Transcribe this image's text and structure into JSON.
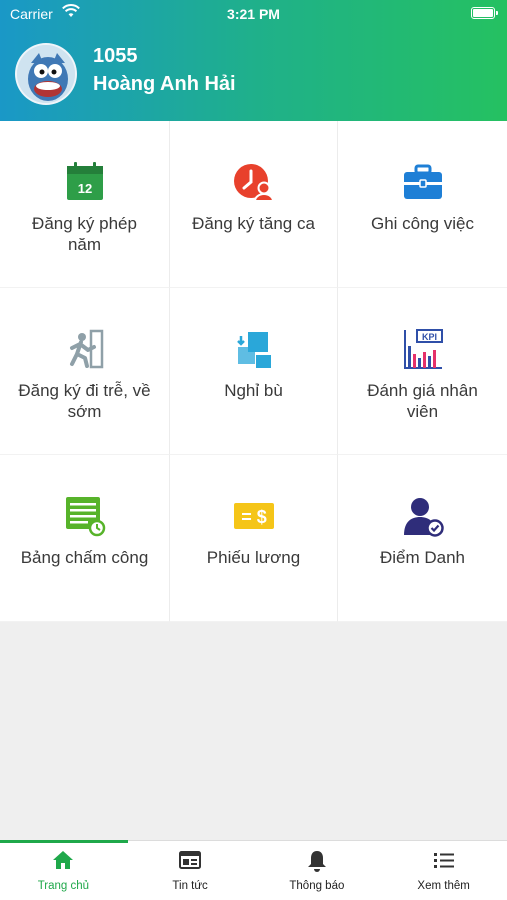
{
  "status_bar": {
    "carrier": "Carrier",
    "time": "3:21 PM",
    "battery_level": 1.0
  },
  "user": {
    "id": "1055",
    "name": "Hoàng Anh Hải"
  },
  "menu_items": [
    {
      "label": "Đăng ký phép năm",
      "icon": "calendar-icon",
      "calendar_day": "12",
      "color": "#2e9e48"
    },
    {
      "label": "Đăng ký tăng ca",
      "icon": "overtime-icon",
      "color": "#e8412c"
    },
    {
      "label": "Ghi công việc",
      "icon": "briefcase-icon",
      "color": "#1e7fd6"
    },
    {
      "label": "Đăng ký đi trễ, về sớm",
      "icon": "exit-running-icon",
      "color": "#8fa0a8"
    },
    {
      "label": "Nghỉ bù",
      "icon": "swap-squares-icon",
      "color": "#2aa7d9"
    },
    {
      "label": "Đánh giá nhân viên",
      "icon": "kpi-chart-icon",
      "kpi_text": "KPI",
      "color": "#2f4fa8"
    },
    {
      "label": "Bảng chấm công",
      "icon": "timesheet-icon",
      "color": "#57b32a"
    },
    {
      "label": "Phiếu lương",
      "icon": "salary-slip-icon",
      "slip_text": "= $",
      "color": "#f5c518"
    },
    {
      "label": "Điểm Danh",
      "icon": "user-check-icon",
      "color": "#2f2d7a"
    }
  ],
  "tabs": [
    {
      "label": "Trang chủ",
      "icon": "home-icon",
      "active": true
    },
    {
      "label": "Tin tức",
      "icon": "news-icon",
      "active": false
    },
    {
      "label": "Thông báo",
      "icon": "bell-icon",
      "active": false
    },
    {
      "label": "Xem thêm",
      "icon": "list-icon",
      "active": false
    }
  ],
  "colors": {
    "header_start": "#1a98c7",
    "header_end": "#25c161",
    "active_tab": "#1fa84a"
  }
}
